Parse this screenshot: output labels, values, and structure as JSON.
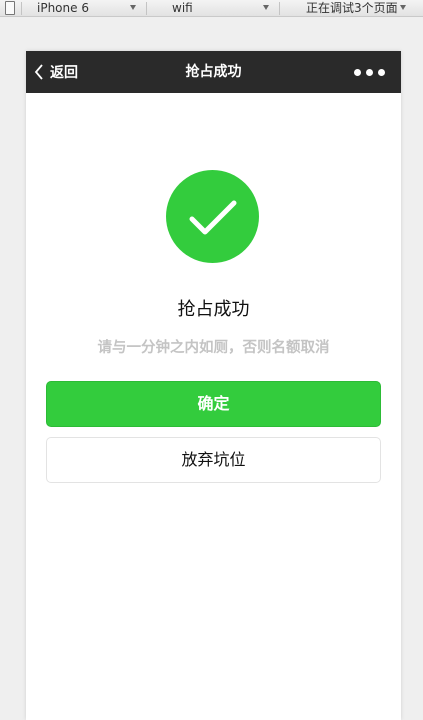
{
  "toolbar": {
    "device": "iPhone 6",
    "network": "wifi",
    "debug_status": "正在调试3个页面"
  },
  "navbar": {
    "back_label": "返回",
    "title": "抢占成功",
    "more_icon": "ellipsis-icon"
  },
  "result": {
    "icon": "success-check-icon",
    "title": "抢占成功",
    "description": "请与一分钟之内如厕，否则名额取消"
  },
  "buttons": {
    "confirm_label": "确定",
    "abandon_label": "放弃坑位"
  },
  "colors": {
    "primary": "#33cc3d",
    "navbar_bg": "#2a2a2a",
    "desc_text": "#c4c4c4",
    "page_bg": "#efefef"
  }
}
